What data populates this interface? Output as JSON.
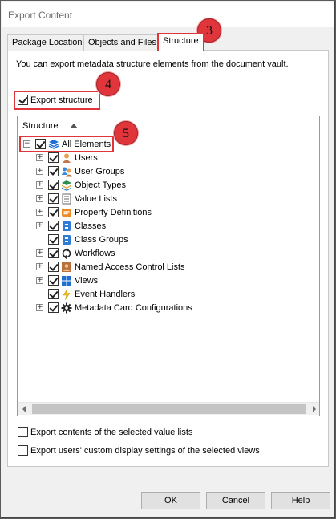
{
  "window": {
    "title": "Export Content"
  },
  "tabs": [
    {
      "label": "Package Location"
    },
    {
      "label": "Objects and Files"
    },
    {
      "label": "Structure"
    }
  ],
  "description": "You can export metadata structure elements from the document vault.",
  "export_structure": {
    "label": "Export structure",
    "checked": true
  },
  "tree": {
    "header": "Structure",
    "root": {
      "label": "All Elements",
      "expander": "−"
    },
    "items": [
      {
        "label": "Users",
        "icon": "user-icon",
        "expander": "+"
      },
      {
        "label": "User Groups",
        "icon": "user-groups-icon",
        "expander": "+"
      },
      {
        "label": "Object Types",
        "icon": "object-types-icon",
        "expander": "+"
      },
      {
        "label": "Value Lists",
        "icon": "value-lists-icon",
        "expander": "+"
      },
      {
        "label": "Property Definitions",
        "icon": "property-definitions-icon",
        "expander": "+"
      },
      {
        "label": "Classes",
        "icon": "classes-icon",
        "expander": "+"
      },
      {
        "label": "Class Groups",
        "icon": "class-groups-icon",
        "expander": ""
      },
      {
        "label": "Workflows",
        "icon": "workflows-icon",
        "expander": "+"
      },
      {
        "label": "Named Access Control Lists",
        "icon": "named-acl-icon",
        "expander": "+"
      },
      {
        "label": "Views",
        "icon": "views-icon",
        "expander": "+"
      },
      {
        "label": "Event Handlers",
        "icon": "event-handlers-icon",
        "expander": ""
      },
      {
        "label": "Metadata Card Configurations",
        "icon": "gear-icon",
        "expander": "+"
      }
    ]
  },
  "options": [
    {
      "label": "Export contents of the selected value lists",
      "checked": false
    },
    {
      "label": "Export users' custom display settings of the selected views",
      "checked": false
    }
  ],
  "buttons": {
    "ok": "OK",
    "cancel": "Cancel",
    "help": "Help"
  },
  "callouts": [
    "3",
    "4",
    "5"
  ],
  "colors": {
    "callout": "#e0363b"
  }
}
